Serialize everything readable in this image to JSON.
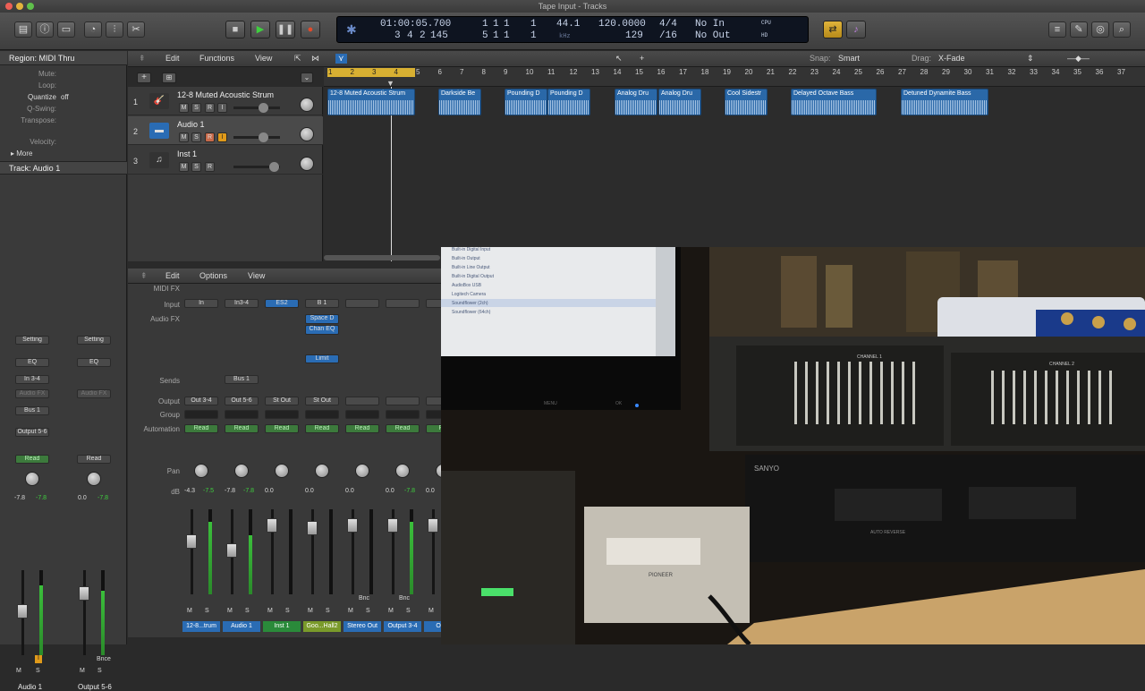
{
  "window": {
    "title": "Tape Input - Tracks"
  },
  "lcd": {
    "time": "01:00:05.700",
    "time_pos": [
      "1",
      "1",
      "1",
      "1"
    ],
    "bars": [
      "3",
      "4",
      "2",
      "145"
    ],
    "bars_pos": [
      "5",
      "1",
      "1",
      "1"
    ],
    "sample_rate": "44.1",
    "sample_unit": "kHz",
    "tempo": "120.0000",
    "tempo_sub": "129",
    "signature": "4/4",
    "division": "/16",
    "in_label": "No In",
    "out_label": "No Out",
    "cpu": "CPU",
    "hd": "HD"
  },
  "inspector": {
    "region_header": "Region: MIDI Thru",
    "mute_label": "Mute:",
    "loop_label": "Loop:",
    "quantize_label": "Quantize",
    "quantize_value": "off",
    "qswing_label": "Q-Swing:",
    "transpose_label": "Transpose:",
    "velocity_label": "Velocity:",
    "more_label": "More",
    "track_header": "Track: Audio 1",
    "strip1": {
      "setting": "Setting",
      "eq": "EQ",
      "input": "In 3-4",
      "audiofx": "Audio FX",
      "bus": "Bus 1",
      "output": "Output 5-6",
      "automation": "Read",
      "db1": "-7.8",
      "db2": "-7.8",
      "name": "Audio 1"
    },
    "strip2": {
      "setting": "Setting",
      "eq": "EQ",
      "audiofx": "Audio FX",
      "automation": "Read",
      "db1": "0.0",
      "db2": "-7.8",
      "bnce": "Bnce",
      "name": "Output 5-6"
    }
  },
  "tracks_menu": {
    "edit": "Edit",
    "functions": "Functions",
    "view": "View",
    "snap_label": "Snap:",
    "snap_value": "Smart",
    "drag_label": "Drag:",
    "drag_value": "X-Fade"
  },
  "ruler": [
    "1",
    "2",
    "3",
    "4",
    "5",
    "6",
    "7",
    "8",
    "9",
    "10",
    "11",
    "12",
    "13",
    "14",
    "15",
    "16",
    "17",
    "18",
    "19",
    "20",
    "21",
    "22",
    "23",
    "24",
    "25",
    "26",
    "27",
    "28",
    "29",
    "30",
    "31",
    "32",
    "33",
    "34",
    "35",
    "36",
    "37"
  ],
  "tracks": [
    {
      "num": "1",
      "name": "12-8 Muted Acoustic Strum"
    },
    {
      "num": "2",
      "name": "Audio 1"
    },
    {
      "num": "3",
      "name": "Inst 1"
    }
  ],
  "regions": [
    {
      "name": "12-8 Muted Acoustic Strum"
    },
    {
      "name": "Darkside Be"
    },
    {
      "name": "Pounding D"
    },
    {
      "name": "Pounding D"
    },
    {
      "name": "Analog Dru"
    },
    {
      "name": "Analog Dru"
    },
    {
      "name": "Cool Sidestr"
    },
    {
      "name": "Delayed Octave Bass"
    },
    {
      "name": "Detuned Dynamite Bass"
    }
  ],
  "mixer_menu": {
    "edit": "Edit",
    "options": "Options",
    "view": "View"
  },
  "mixer_labels": {
    "midifx": "MIDI FX",
    "input": "Input",
    "audiofx": "Audio FX",
    "sends": "Sends",
    "output": "Output",
    "group": "Group",
    "automation": "Automation",
    "pan": "Pan",
    "db": "dB"
  },
  "strips": [
    {
      "input": "In",
      "output": "Out 3-4",
      "auto": "Read",
      "db1": "-4.3",
      "db2": "-7.5",
      "name": "12-8...trum",
      "color": "#2a6cb4"
    },
    {
      "input": "In3-4",
      "output": "Out 5-6",
      "auto": "Read",
      "send": "Bus 1",
      "db1": "-7.8",
      "db2": "-7.8",
      "name": "Audio 1",
      "color": "#2a6cb4"
    },
    {
      "input": "ES2",
      "output": "St Out",
      "auto": "Read",
      "db1": "0.0",
      "db2": "",
      "name": "Inst 1",
      "color": "#2a8a3a"
    },
    {
      "input": "B 1",
      "fx1": "Space D",
      "fx2": "Chan EQ",
      "fx3": "Limit",
      "output": "St Out",
      "auto": "Read",
      "db1": "0.0",
      "db2": "",
      "name": "Goo...Hall2",
      "color": "#7a9a2a"
    },
    {
      "input": "",
      "output": "",
      "auto": "Read",
      "db1": "0.0",
      "db2": "",
      "bnc": "Bnc",
      "name": "Stereo Out",
      "color": "#2a6cb4"
    },
    {
      "input": "",
      "output": "",
      "auto": "Read",
      "db1": "0.0",
      "db2": "-7.8",
      "bnc": "Bnc",
      "name": "Output 3-4",
      "color": "#2a6cb4"
    },
    {
      "input": "",
      "output": "",
      "auto": "Re",
      "db1": "0.0",
      "db2": "",
      "name": "Outp",
      "color": "#2a6cb4"
    }
  ],
  "video": {
    "label": "Camera view: audio interface, equalizers, cassette deck and amplifier",
    "labels": {
      "menu": "MENU",
      "ok": "OK",
      "pioneer": "PIONEER",
      "sanyo": "SANYO",
      "auto_reverse": "AUTO REVERSE",
      "channel1": "CHANNEL 1",
      "channel2": "CHANNEL 2"
    }
  },
  "monitor_list": [
    "Built-in Digital Input",
    "Built-in Output",
    "Built-in Line Output",
    "Built-in Digital Output",
    "AudioBox USB",
    "Logitech Camera",
    "Soundflower (2ch)",
    "Soundflower (64ch)"
  ]
}
